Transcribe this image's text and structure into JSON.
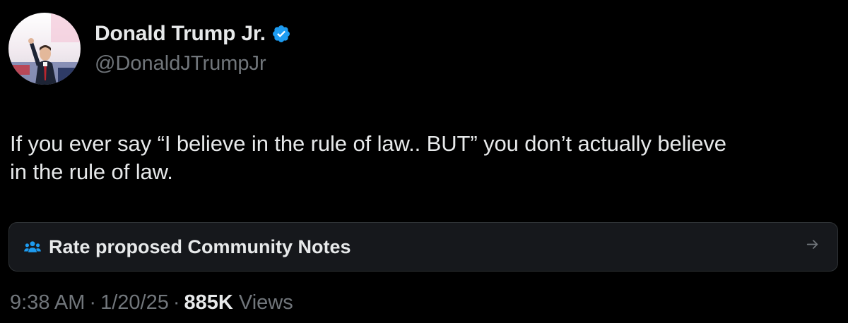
{
  "author": {
    "display_name": "Donald Trump Jr.",
    "handle": "@DonaldJTrumpJr",
    "verified_icon": "verified-badge-icon",
    "avatar_icon": "profile-photo"
  },
  "tweet": {
    "text": "If you ever say “I believe in the rule of law.. BUT” you don’t actually believe\nin the rule of law."
  },
  "community_notes": {
    "label": "Rate proposed Community Notes",
    "icon": "people-icon",
    "arrow_icon": "arrow-right-icon"
  },
  "meta": {
    "time": "9:38 AM",
    "separator": "·",
    "date": "1/20/25",
    "views_count": "885K",
    "views_label": "Views"
  },
  "colors": {
    "background": "#000000",
    "text": "#e7e9ea",
    "secondary_text": "#71767b",
    "verified_blue": "#1d9bf0",
    "notes_box_bg": "#16181c",
    "border": "#2f3336"
  }
}
